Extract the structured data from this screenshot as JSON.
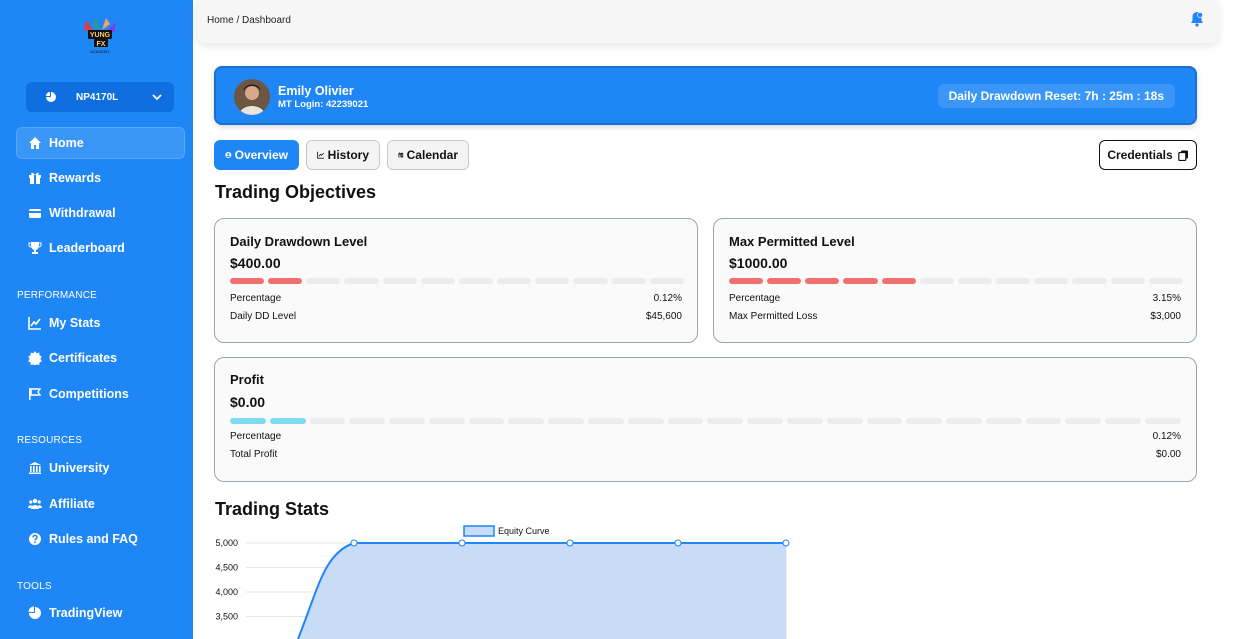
{
  "brand": {
    "logo_text": "YUNG FX ACADEMY"
  },
  "sidebar": {
    "account": {
      "label": "NP4170L"
    },
    "items": [
      {
        "label": "Home",
        "icon": "home-icon"
      },
      {
        "label": "Rewards",
        "icon": "gift-icon"
      },
      {
        "label": "Withdrawal",
        "icon": "wallet-icon"
      },
      {
        "label": "Leaderboard",
        "icon": "trophy-icon"
      }
    ],
    "performance_title": "PERFORMANCE",
    "performance": [
      {
        "label": "My Stats",
        "icon": "chart-line-icon"
      },
      {
        "label": "Certificates",
        "icon": "certificate-icon"
      },
      {
        "label": "Competitions",
        "icon": "flag-icon"
      }
    ],
    "resources_title": "RESOURCES",
    "resources": [
      {
        "label": "University",
        "icon": "university-icon"
      },
      {
        "label": "Affiliate",
        "icon": "users-icon"
      },
      {
        "label": "Rules and FAQ",
        "icon": "question-icon"
      }
    ],
    "tools_title": "TOOLS",
    "tools": [
      {
        "label": "TradingView",
        "icon": "pie-chart-icon"
      }
    ]
  },
  "topbar": {
    "breadcrumb": "Home / Dashboard"
  },
  "banner": {
    "name": "Emily Olivier",
    "login": "MT Login: 42239021",
    "reset": "Daily Drawdown Reset: 7h : 25m : 18s"
  },
  "tabs": {
    "overview": "Overview",
    "history": "History",
    "calendar": "Calendar",
    "credentials": "Credentials"
  },
  "objectives": {
    "title": "Trading Objectives",
    "daily": {
      "title": "Daily Drawdown Level",
      "amount": "$400.00",
      "fill_segments": 2,
      "total_segments": 12,
      "color": "#f07070",
      "rows": [
        {
          "label": "Percentage",
          "value": "0.12%"
        },
        {
          "label": "Daily DD Level",
          "value": "$45,600"
        }
      ]
    },
    "max": {
      "title": "Max Permitted Level",
      "amount": "$1000.00",
      "fill_segments": 5,
      "total_segments": 12,
      "color": "#f07070",
      "rows": [
        {
          "label": "Percentage",
          "value": "3.15%"
        },
        {
          "label": "Max Permitted Loss",
          "value": "$3,000"
        }
      ]
    },
    "profit": {
      "title": "Profit",
      "amount": "$0.00",
      "fill_segments": 2,
      "total_segments": 24,
      "color": "#7fdbef",
      "rows": [
        {
          "label": "Percentage",
          "value": "0.12%"
        },
        {
          "label": "Total Profit",
          "value": "$0.00"
        }
      ]
    }
  },
  "stats": {
    "title": "Trading Stats"
  },
  "chart_data": {
    "type": "area",
    "series": [
      {
        "name": "Equity Curve",
        "values": [
          2800,
          5000,
          5000,
          5000,
          5000,
          5000
        ]
      }
    ],
    "y_ticks": [
      "5,000",
      "4,500",
      "4,000",
      "3,500"
    ],
    "ylim": [
      2800,
      5000
    ],
    "grid": true,
    "legend": "top",
    "color": "#1f86f5"
  }
}
